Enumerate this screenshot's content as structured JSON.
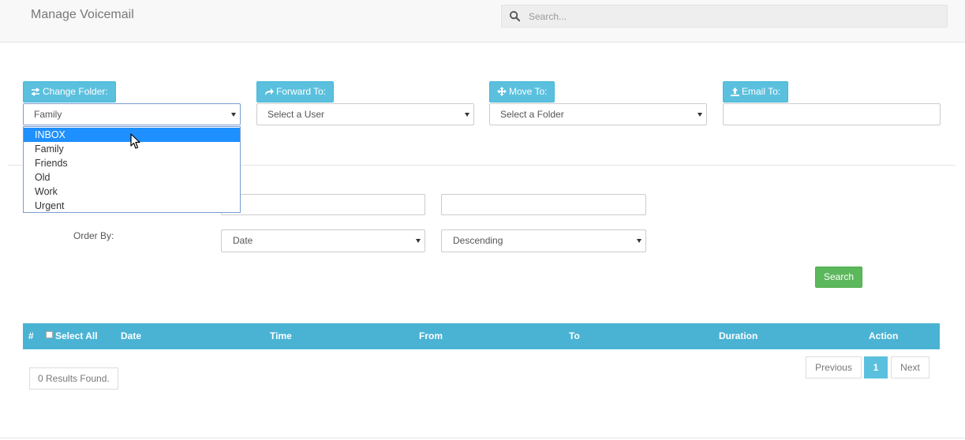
{
  "header": {
    "title": "Manage Voicemail",
    "search_placeholder": "Search...",
    "search_icon": "search-icon"
  },
  "actions": {
    "change_folder": {
      "label": "Change Folder:",
      "icon": "exchange-icon",
      "value": "Family"
    },
    "forward_to": {
      "label": "Forward To:",
      "icon": "share-icon",
      "value": "Select a User"
    },
    "move_to": {
      "label": "Move To:",
      "icon": "move-icon",
      "value": "Select a Folder"
    },
    "email_to": {
      "label": "Email To:",
      "icon": "upload-icon",
      "value": ""
    }
  },
  "folder_dropdown": {
    "options": [
      "INBOX",
      "Family",
      "Friends",
      "Old",
      "Work",
      "Urgent"
    ],
    "highlighted": "INBOX"
  },
  "filters": {
    "order_by_label": "Order By:",
    "order_field": "Date",
    "order_direction": "Descending",
    "search_button": "Search"
  },
  "table": {
    "columns": [
      "#",
      "Select All",
      "Date",
      "Time",
      "From",
      "To",
      "Duration",
      "Action"
    ],
    "header_color": "#4ab3d4"
  },
  "results": {
    "summary": "0 Results Found."
  },
  "pagination": {
    "previous": "Previous",
    "current": "1",
    "next": "Next"
  },
  "colors": {
    "info": "#5bc0de",
    "success": "#5cb85c",
    "selected": "#1e90ff"
  }
}
